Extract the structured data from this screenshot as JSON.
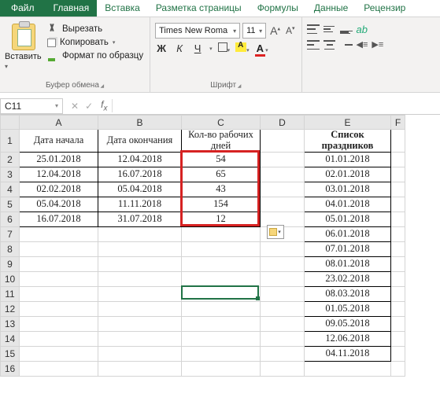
{
  "tabs": {
    "file": "Файл",
    "home": "Главная",
    "insert": "Вставка",
    "layout": "Разметка страницы",
    "formulas": "Формулы",
    "data": "Данные",
    "review": "Рецензир"
  },
  "ribbon": {
    "clipboard": {
      "paste": "Вставить",
      "cut": "Вырезать",
      "copy": "Копировать",
      "format_painter": "Формат по образцу",
      "group_label": "Буфер обмена"
    },
    "font": {
      "name": "Times New Roma",
      "size": "11",
      "bold": "Ж",
      "italic": "К",
      "underline": "Ч",
      "group_label": "Шрифт"
    },
    "alignment": {
      "group_label": ""
    }
  },
  "namebox": "C11",
  "formula": "",
  "columns": [
    "A",
    "B",
    "C",
    "D",
    "E",
    "F"
  ],
  "header_row": {
    "A": "Дата начала",
    "B": "Дата окончания",
    "C": "Кол-во рабочих дней",
    "E": "Список праздников"
  },
  "rows": [
    {
      "n": 2,
      "A": "25.01.2018",
      "B": "12.04.2018",
      "C": "54",
      "E": "01.01.2018"
    },
    {
      "n": 3,
      "A": "12.04.2018",
      "B": "16.07.2018",
      "C": "65",
      "E": "02.01.2018"
    },
    {
      "n": 4,
      "A": "02.02.2018",
      "B": "05.04.2018",
      "C": "43",
      "E": "03.01.2018"
    },
    {
      "n": 5,
      "A": "05.04.2018",
      "B": "11.11.2018",
      "C": "154",
      "E": "04.01.2018"
    },
    {
      "n": 6,
      "A": "16.07.2018",
      "B": "31.07.2018",
      "C": "12",
      "E": "05.01.2018"
    },
    {
      "n": 7,
      "E": "06.01.2018"
    },
    {
      "n": 8,
      "E": "07.01.2018"
    },
    {
      "n": 9,
      "E": "08.01.2018"
    },
    {
      "n": 10,
      "E": "23.02.2018"
    },
    {
      "n": 11,
      "E": "08.03.2018"
    },
    {
      "n": 12,
      "E": "01.05.2018"
    },
    {
      "n": 13,
      "E": "09.05.2018"
    },
    {
      "n": 14,
      "E": "12.06.2018"
    },
    {
      "n": 15,
      "E": "04.11.2018"
    },
    {
      "n": 16
    }
  ],
  "active_cell": "C11"
}
